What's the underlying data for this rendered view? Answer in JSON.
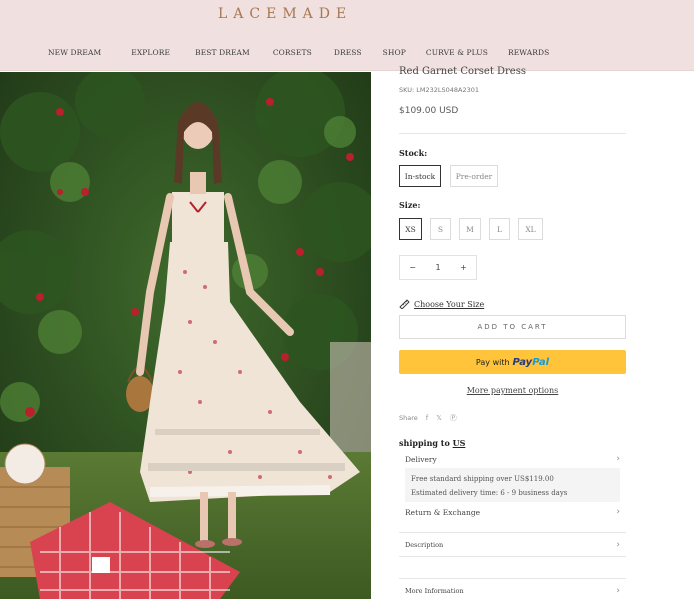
{
  "brand": {
    "logo_text": "LACEMADE"
  },
  "nav": {
    "items": [
      "NEW DREAM",
      "EXPLORE",
      "BEST DREAM",
      "CORSETS",
      "DRESS",
      "SHOP",
      "CURVE & PLUS",
      "REWARDS"
    ]
  },
  "product": {
    "title": "Red Garnet Corset Dress",
    "sku": "SKU: LM232LS048A2301",
    "price": "$109.00 USD"
  },
  "stock": {
    "label": "Stock:",
    "options": [
      "In-stock",
      "Pre-order"
    ],
    "selected": "In-stock"
  },
  "size": {
    "label": "Size:",
    "options": [
      "XS",
      "S",
      "M",
      "L",
      "XL"
    ],
    "selected": "XS"
  },
  "quantity": {
    "minus": "−",
    "value": "1",
    "plus": "+"
  },
  "size_guide": {
    "label": "Choose Your Size"
  },
  "buttons": {
    "add_to_cart": "ADD TO CART",
    "paypal_prefix": "Pay with",
    "paypal_brand_1": "Pay",
    "paypal_brand_2": "Pal",
    "more_payment": "More payment options"
  },
  "share": {
    "label": "Share",
    "icons": [
      "facebook-icon",
      "twitter-icon",
      "pinterest-icon"
    ]
  },
  "shipping": {
    "title_prefix": "shipping to",
    "country": "US",
    "delivery_label": "Delivery",
    "delivery_line1": "Free standard shipping over US$119.00",
    "delivery_line2": "Estimated delivery time: 6 - 9 business days",
    "return_label": "Return & Exchange"
  },
  "sections": {
    "description": "Description",
    "more_info": "More Information"
  },
  "colors": {
    "header_bg": "#f0e0e0",
    "paypal_yellow": "#ffc43a",
    "paypal_dark_blue": "#253b80",
    "paypal_light_blue": "#179bd7"
  }
}
